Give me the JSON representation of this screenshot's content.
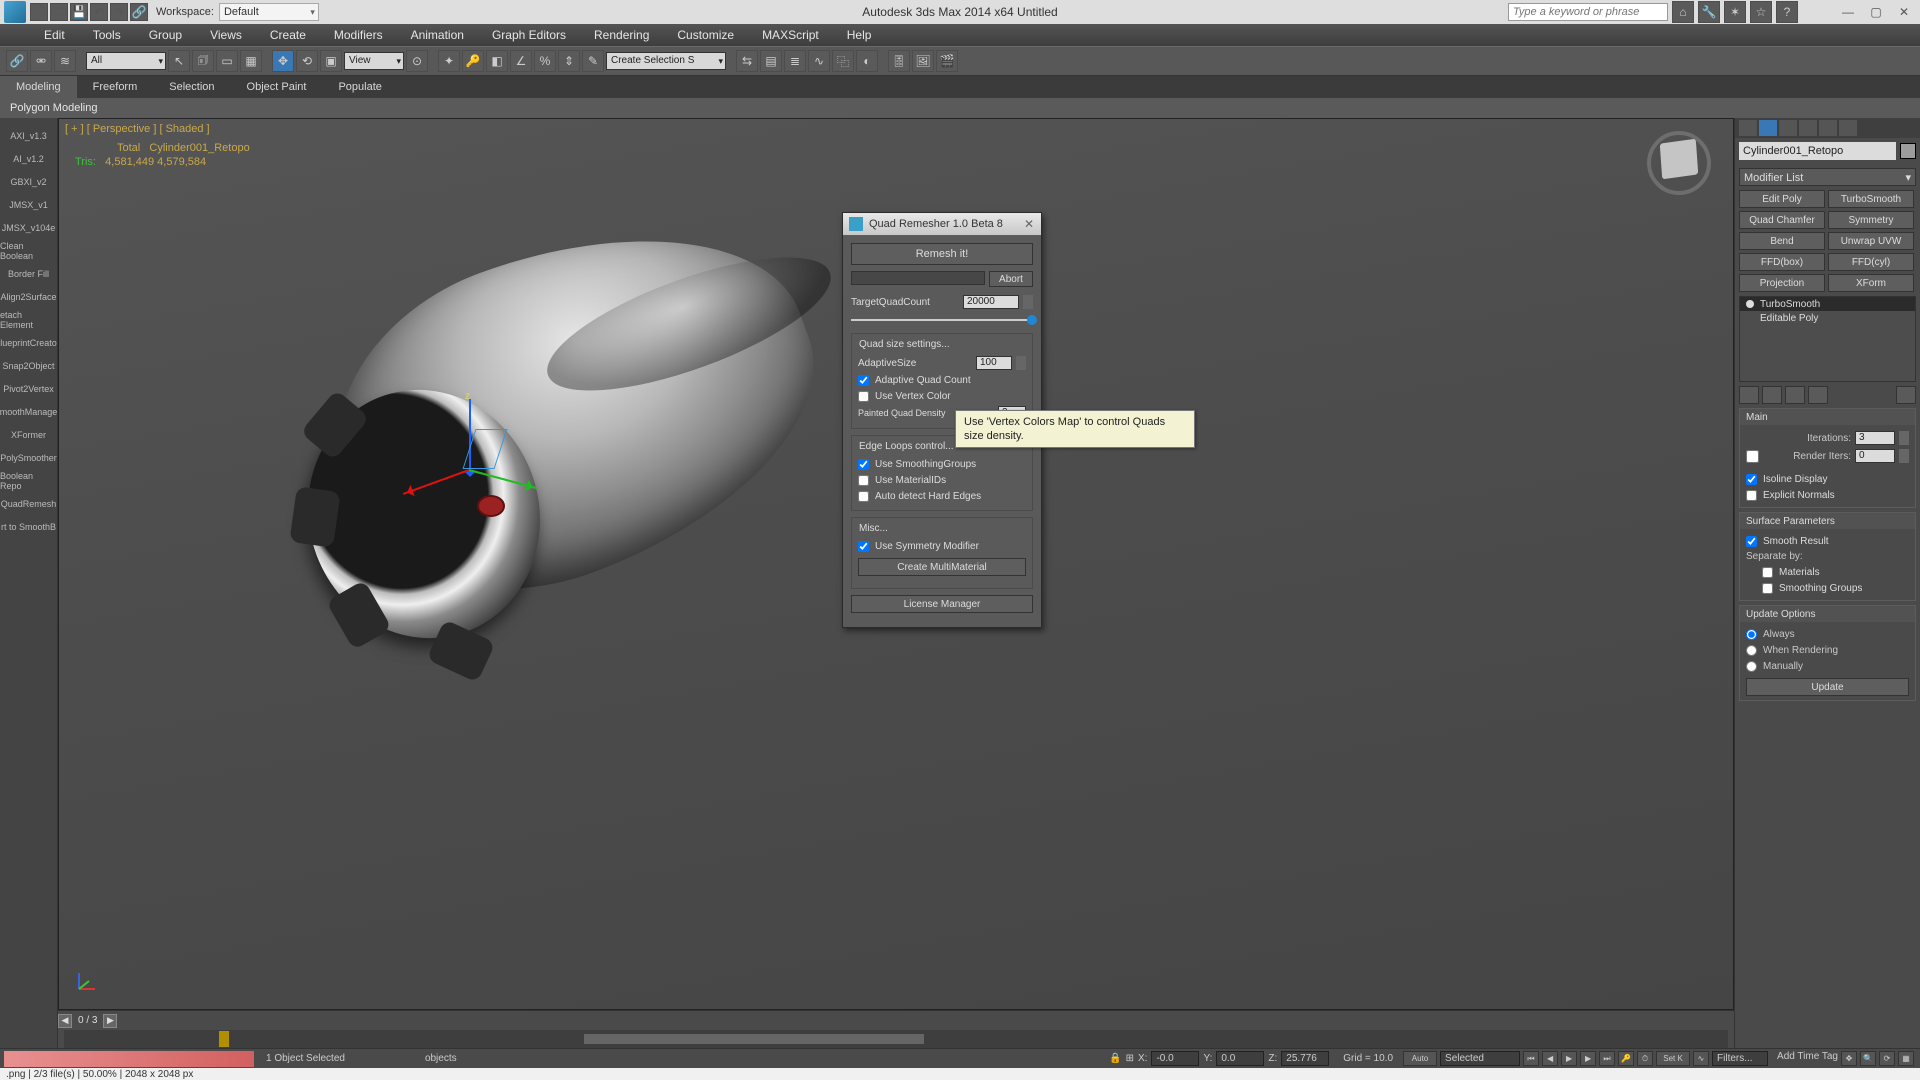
{
  "titlebar": {
    "workspace_label": "Workspace:",
    "workspace_value": "Default",
    "app_title": "Autodesk 3ds Max  2014 x64      Untitled",
    "search_placeholder": "Type a keyword or phrase"
  },
  "menus": [
    "Edit",
    "Tools",
    "Group",
    "Views",
    "Create",
    "Modifiers",
    "Animation",
    "Graph Editors",
    "Rendering",
    "Customize",
    "MAXScript",
    "Help"
  ],
  "toolbar": {
    "selset_label": "All",
    "view_sel": "View",
    "create_sel": "Create Selection S"
  },
  "ribbon": {
    "tabs": [
      "Modeling",
      "Freeform",
      "Selection",
      "Object Paint",
      "Populate"
    ],
    "active": 0,
    "sub": "Polygon Modeling"
  },
  "scripts": [
    "AXI_v1.3",
    "AI_v1.2",
    "GBXI_v2",
    "JMSX_v1",
    "JMSX_v104e",
    "Clean Boolean",
    "Border Fill",
    "Align2Surface",
    "etach Element",
    "lueprintCreato",
    "Snap2Object",
    "Pivot2Vertex",
    "moothManage",
    "XFormer",
    "PolySmoother",
    "Boolean Repo",
    "QuadRemesh",
    "rt to SmoothB"
  ],
  "viewport": {
    "label": "[ + ] [ Perspective ] [ Shaded ]",
    "stats_header_total": "Total",
    "stats_header_obj": "Cylinder001_Retopo",
    "stats_row_label": "Tris:",
    "stats_total": "4,581,449",
    "stats_obj": "4,579,584",
    "timeline_page": "0 / 3"
  },
  "dialog": {
    "title": "Quad Remesher 1.0 Beta 8",
    "remesh": "Remesh it!",
    "abort": "Abort",
    "target_label": "TargetQuadCount",
    "target_value": "20000",
    "group_size": "Quad size settings...",
    "adaptive_size_label": "AdaptiveSize",
    "adaptive_size_value": "100",
    "chk_adaptive": "Adaptive Quad Count",
    "chk_vertexcolor": "Use Vertex Color",
    "density_label": "Painted Quad Density",
    "density_value": "2.",
    "group_edges": "Edge Loops control...",
    "chk_sg": "Use SmoothingGroups",
    "chk_mid": "Use MaterialIDs",
    "chk_hard": "Auto detect Hard Edges",
    "group_misc": "Misc...",
    "chk_sym": "Use Symmetry Modifier",
    "btn_multimat": "Create MultiMaterial",
    "btn_lic": "License Manager"
  },
  "tooltip": "Use 'Vertex Colors Map' to control Quads size density.",
  "cmd_panel": {
    "object_name": "Cylinder001_Retopo",
    "modifier_list": "Modifier List",
    "mod_buttons": [
      "Edit Poly",
      "TurboSmooth",
      "Quad Chamfer",
      "Symmetry",
      "Bend",
      "Unwrap UVW",
      "FFD(box)",
      "FFD(cyl)",
      "Projection",
      "XForm"
    ],
    "stack": [
      "TurboSmooth",
      "Editable Poly"
    ],
    "rollout_main": "Main",
    "iterations_label": "Iterations:",
    "iterations_value": "3",
    "render_iters_label": "Render Iters:",
    "render_iters_value": "0",
    "chk_isoline": "Isoline Display",
    "chk_explicit": "Explicit Normals",
    "group_surface": "Surface Parameters",
    "chk_smooth_result": "Smooth Result",
    "sep_label": "Separate by:",
    "chk_materials": "Materials",
    "chk_sg": "Smoothing Groups",
    "group_update": "Update Options",
    "rad_always": "Always",
    "rad_render": "When Rendering",
    "rad_manual": "Manually",
    "btn_update": "Update"
  },
  "statusbar": {
    "selected": "1 Object Selected",
    "x_label": "X:",
    "x_val": "-0.0",
    "y_label": "Y:",
    "y_val": "0.0",
    "z_label": "Z:",
    "z_val": "25.776",
    "grid_label": "Grid = 10.0",
    "auto": "Auto",
    "setk": "Set K",
    "selected_filter": "Selected",
    "filters": "Filters...",
    "add_time_tag": "Add Time Tag",
    "objects": "objects"
  },
  "bottom": {
    "file_info": ".png  |  2/3 file(s)  |  50.00%  |  2048 x 2048 px"
  }
}
